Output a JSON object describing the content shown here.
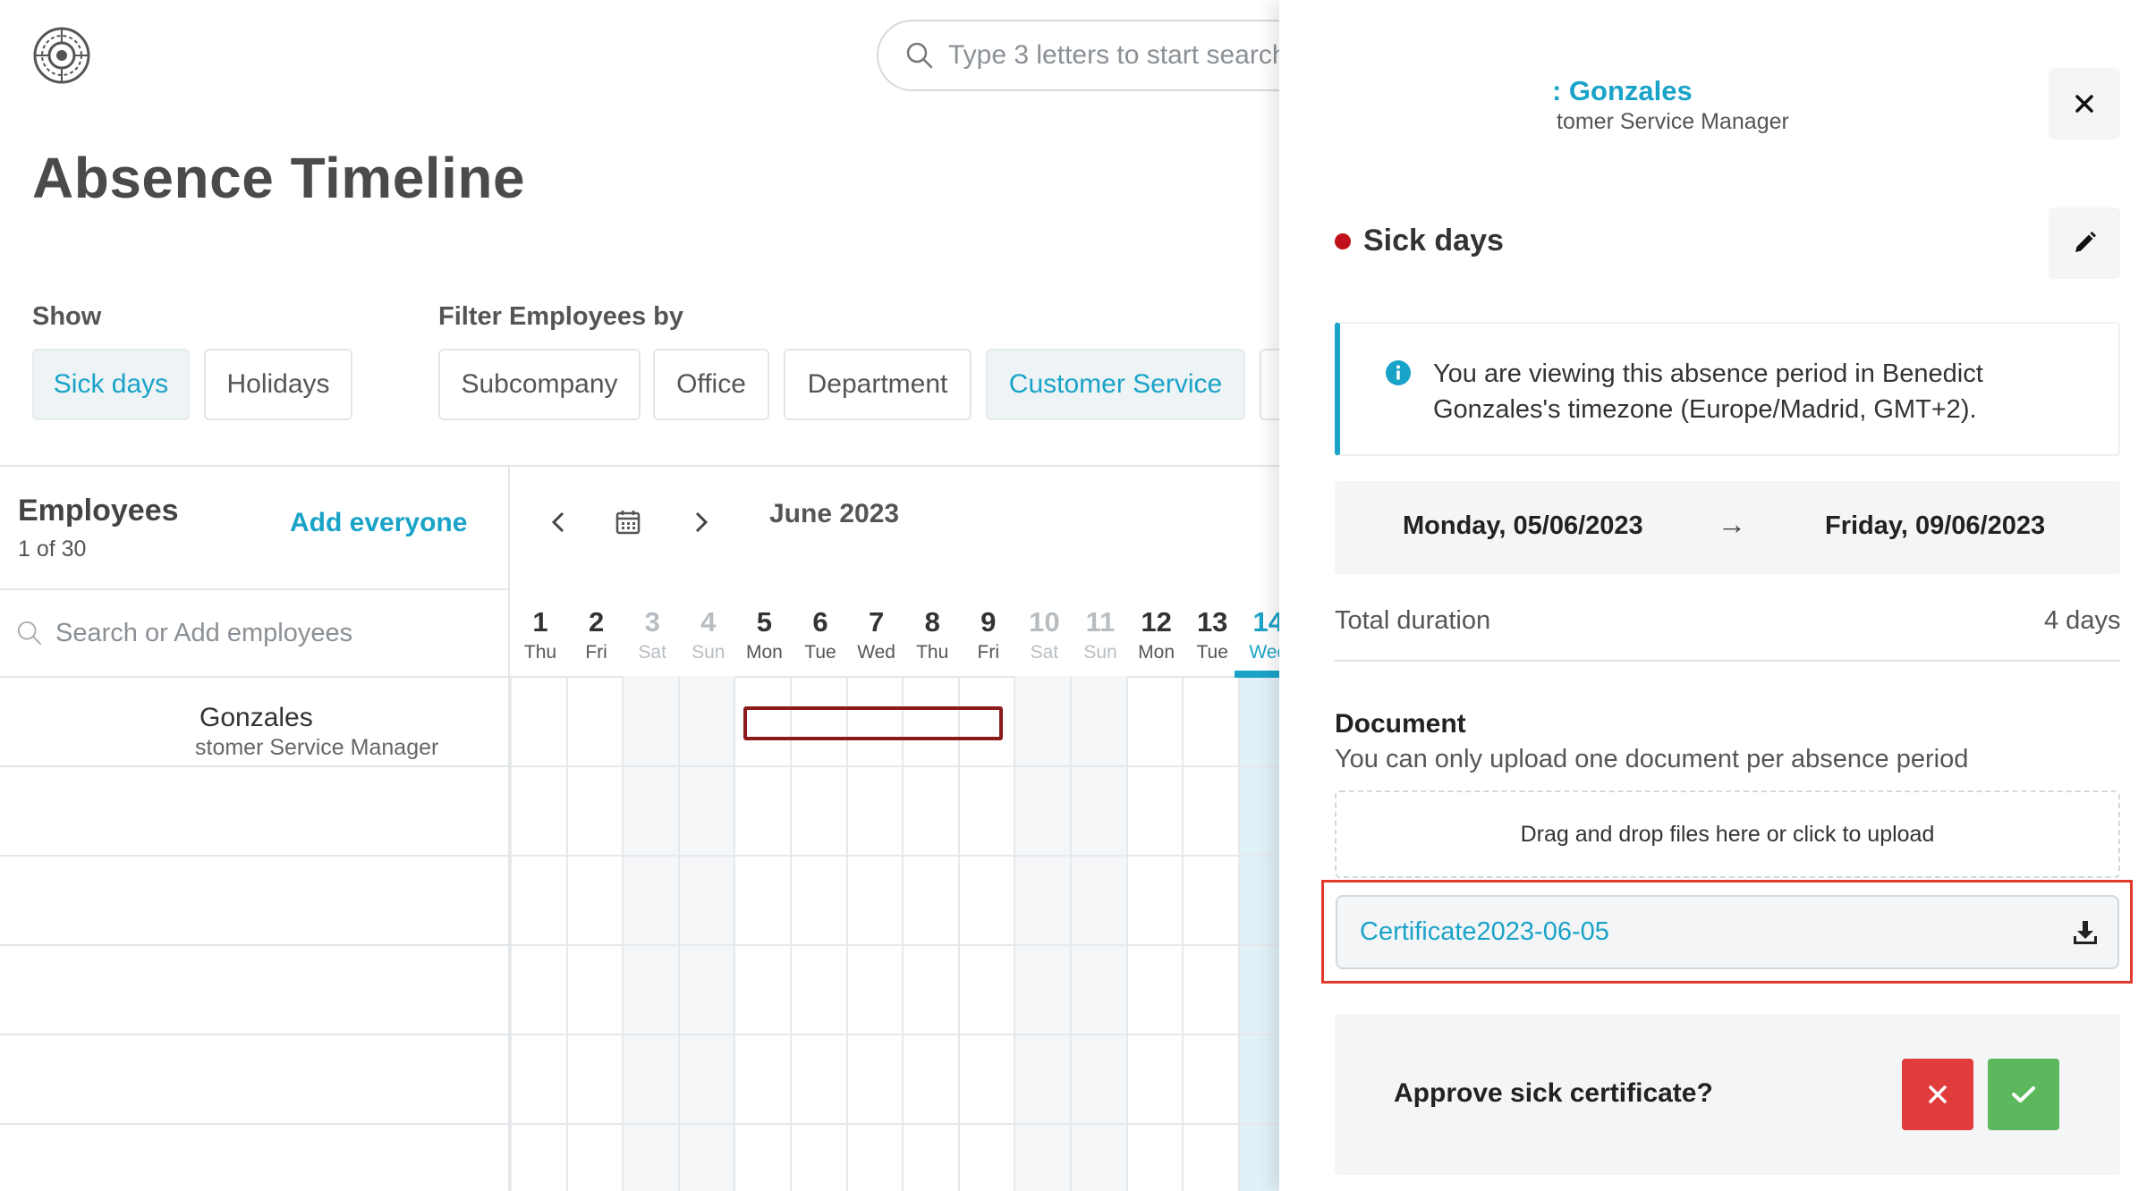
{
  "app": {
    "search_placeholder": "Type 3 letters to start search",
    "page_title": "Absence Timeline"
  },
  "filters": {
    "show_label": "Show",
    "show_options": [
      {
        "label": "Sick days",
        "active": true
      },
      {
        "label": "Holidays",
        "active": false
      }
    ],
    "filter_label": "Filter Employees by",
    "filter_options": [
      {
        "label": "Subcompany",
        "active": false
      },
      {
        "label": "Office",
        "active": false
      },
      {
        "label": "Department",
        "active": false
      },
      {
        "label": "Customer Service",
        "active": true
      }
    ]
  },
  "employees": {
    "title": "Employees",
    "count": "1 of 30",
    "add_everyone": "Add everyone",
    "search_placeholder": "Search or Add employees",
    "rows": [
      {
        "name": "Gonzales",
        "role": "stomer Service Manager"
      }
    ]
  },
  "calendar": {
    "month": "June 2023",
    "days": [
      {
        "num": "1",
        "name": "Thu",
        "weekend": false,
        "today": false
      },
      {
        "num": "2",
        "name": "Fri",
        "weekend": false,
        "today": false
      },
      {
        "num": "3",
        "name": "Sat",
        "weekend": true,
        "today": false
      },
      {
        "num": "4",
        "name": "Sun",
        "weekend": true,
        "today": false
      },
      {
        "num": "5",
        "name": "Mon",
        "weekend": false,
        "today": false
      },
      {
        "num": "6",
        "name": "Tue",
        "weekend": false,
        "today": false
      },
      {
        "num": "7",
        "name": "Wed",
        "weekend": false,
        "today": false
      },
      {
        "num": "8",
        "name": "Thu",
        "weekend": false,
        "today": false
      },
      {
        "num": "9",
        "name": "Fri",
        "weekend": false,
        "today": false
      },
      {
        "num": "10",
        "name": "Sat",
        "weekend": true,
        "today": false
      },
      {
        "num": "11",
        "name": "Sun",
        "weekend": true,
        "today": false
      },
      {
        "num": "12",
        "name": "Mon",
        "weekend": false,
        "today": false
      },
      {
        "num": "13",
        "name": "Tue",
        "weekend": false,
        "today": false
      },
      {
        "num": "14",
        "name": "Wed",
        "weekend": false,
        "today": true
      }
    ],
    "absence_color": "#8b1a1a"
  },
  "panel": {
    "employee_name": ": Gonzales",
    "employee_role": "tomer Service Manager",
    "absence_type": "Sick days",
    "absence_color": "#c0111a",
    "info_message": "You are viewing this absence period in Benedict Gonzales's timezone (Europe/Madrid, GMT+2).",
    "start_date": "Monday, 05/06/2023",
    "arrow": "→",
    "end_date": "Friday, 09/06/2023",
    "duration_label": "Total duration",
    "duration_value": "4 days",
    "document_title": "Document",
    "document_subtitle": "You can only upload one document per absence period",
    "dropzone_text": "Drag and drop files here or click to upload",
    "file_name": "Certificate2023-06-05",
    "approve_question": "Approve sick certificate?"
  },
  "colors": {
    "accent": "#1aa3c8",
    "reject": "#e03c3c",
    "accept": "#5cb85c",
    "highlight": "#e23a2a"
  }
}
